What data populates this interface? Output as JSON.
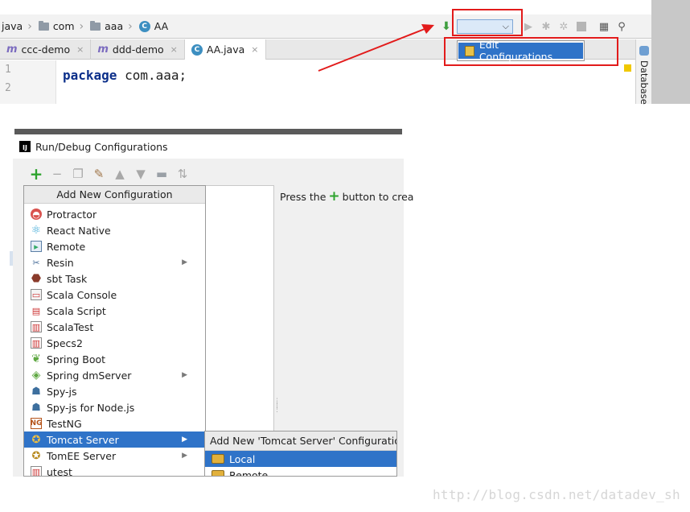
{
  "breadcrumb": [
    {
      "label": "java",
      "icon": "folder-icon"
    },
    {
      "label": "com",
      "icon": "folder-icon"
    },
    {
      "label": "aaa",
      "icon": "folder-icon"
    },
    {
      "label": "AA",
      "icon": "class-c-icon"
    }
  ],
  "toolbar": {
    "class_icon_letter": "C"
  },
  "tabs": [
    {
      "label": "ccc-demo",
      "icon_letter": "m",
      "close": "×"
    },
    {
      "label": "ddd-demo",
      "icon_letter": "m",
      "close": "×"
    },
    {
      "label": "AA.java",
      "icon_letter": "C",
      "close": "×"
    }
  ],
  "editor": {
    "line_numbers": [
      "1",
      "2"
    ],
    "keyword": "package",
    "package_name": "com.aaa;"
  },
  "run_config_menu": {
    "edit_configurations_label": "Edit Configurations..."
  },
  "side_panel": {
    "database_label": "Database"
  },
  "dialog": {
    "title": "Run/Debug Configurations",
    "logo_letter": "IJ",
    "press_text_before": "Press the",
    "press_text_after": "button to crea"
  },
  "add_menu": {
    "header": "Add New Configuration",
    "items": [
      {
        "label": "Protractor",
        "icon": "protractor-icon",
        "submenu": false,
        "selected": false
      },
      {
        "label": "React Native",
        "icon": "react-icon",
        "submenu": false,
        "selected": false
      },
      {
        "label": "Remote",
        "icon": "remote-icon",
        "submenu": false,
        "selected": false
      },
      {
        "label": "Resin",
        "icon": "resin-icon",
        "submenu": true,
        "selected": false
      },
      {
        "label": "sbt Task",
        "icon": "sbt-icon",
        "submenu": false,
        "selected": false
      },
      {
        "label": "Scala Console",
        "icon": "scala-console-icon",
        "submenu": false,
        "selected": false
      },
      {
        "label": "Scala Script",
        "icon": "scala-script-icon",
        "submenu": false,
        "selected": false
      },
      {
        "label": "ScalaTest",
        "icon": "scalatest-icon",
        "submenu": false,
        "selected": false
      },
      {
        "label": "Specs2",
        "icon": "specs2-icon",
        "submenu": false,
        "selected": false
      },
      {
        "label": "Spring Boot",
        "icon": "spring-boot-icon",
        "submenu": false,
        "selected": false
      },
      {
        "label": "Spring dmServer",
        "icon": "spring-dm-icon",
        "submenu": true,
        "selected": false
      },
      {
        "label": "Spy-js",
        "icon": "spyjs-icon",
        "submenu": false,
        "selected": false
      },
      {
        "label": "Spy-js for Node.js",
        "icon": "spyjs-node-icon",
        "submenu": false,
        "selected": false
      },
      {
        "label": "TestNG",
        "icon": "testng-icon",
        "submenu": false,
        "selected": false
      },
      {
        "label": "Tomcat Server",
        "icon": "tomcat-icon",
        "submenu": true,
        "selected": true
      },
      {
        "label": "TomEE Server",
        "icon": "tomee-icon",
        "submenu": true,
        "selected": false
      },
      {
        "label": "utest",
        "icon": "utest-icon",
        "submenu": false,
        "selected": false
      }
    ]
  },
  "tomcat_submenu": {
    "header": "Add New 'Tomcat Server' Configuration",
    "items": [
      {
        "label": "Local",
        "selected": true
      },
      {
        "label": "Remote",
        "selected": false
      }
    ]
  },
  "watermark": "http://blog.csdn.net/datadev_sh",
  "colors": {
    "annotation_red": "#e21b1b",
    "selection_blue": "#2f73c8",
    "add_green": "#2ea32e"
  }
}
